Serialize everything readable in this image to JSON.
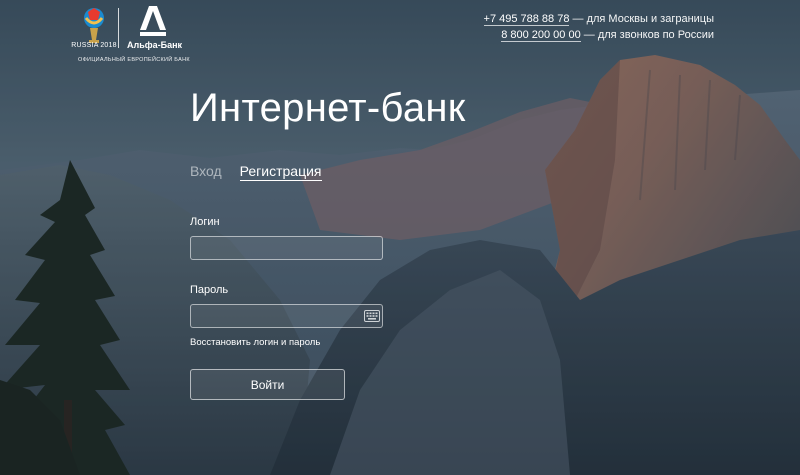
{
  "header": {
    "fifa_logo_text": "RUSSIA 2018",
    "bank_name": "Альфа-Банк",
    "official_label": "ОФИЦИАЛЬНЫЙ ЕВРОПЕЙСКИЙ БАНК",
    "phones": [
      {
        "number": "+7 495 788 88 78",
        "desc": "— для Москвы и заграницы"
      },
      {
        "number": "8 800 200 00 00",
        "desc": "— для звонков по России"
      }
    ]
  },
  "main": {
    "title": "Интернет-банк",
    "tabs": [
      {
        "label": "Вход",
        "active": false
      },
      {
        "label": "Регистрация",
        "active": true
      }
    ],
    "login_label": "Логин",
    "login_value": "",
    "password_label": "Пароль",
    "password_value": "",
    "restore_link": "Восстановить логин и пароль",
    "submit_label": "Войти"
  },
  "icons": {
    "keyboard": "keyboard-icon",
    "alfa_logo": "alfa-a-logo",
    "fifa_logo": "fifa-cup-logo"
  },
  "colors": {
    "accent": "#ffffff",
    "alfa_red": "#ef3124",
    "fifa_gold": "#c9a24a"
  }
}
